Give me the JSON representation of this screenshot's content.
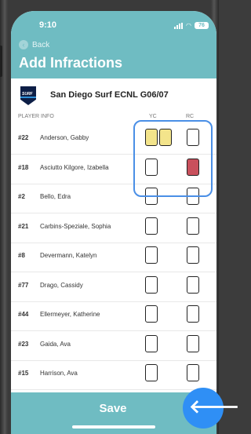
{
  "status": {
    "time": "9:10",
    "battery": "76"
  },
  "nav": {
    "back_label": "Back"
  },
  "page": {
    "title": "Add Infractions"
  },
  "team": {
    "name": "San Diego Surf ECNL G06/07",
    "logo_text": "SURF"
  },
  "columns": {
    "player_info": "PLAYER INFO",
    "yc": "YC",
    "rc": "RC"
  },
  "players": [
    {
      "number": "#22",
      "name": "Anderson, Gabby",
      "yc1": true,
      "yc2": true,
      "rc": false
    },
    {
      "number": "#18",
      "name": "Asciutto Kilgore, Izabella",
      "yc1": false,
      "rc": true
    },
    {
      "number": "#2",
      "name": "Bello, Edra",
      "yc1": false,
      "rc": false
    },
    {
      "number": "#21",
      "name": "Carbins-Speziale, Sophia",
      "yc1": false,
      "rc": false
    },
    {
      "number": "#8",
      "name": "Devermann, Katelyn",
      "yc1": false,
      "rc": false
    },
    {
      "number": "#77",
      "name": "Drago, Cassidy",
      "yc1": false,
      "rc": false
    },
    {
      "number": "#44",
      "name": "Ellermeyer, Katherine",
      "yc1": false,
      "rc": false
    },
    {
      "number": "#23",
      "name": "Gaida, Ava",
      "yc1": false,
      "rc": false
    },
    {
      "number": "#15",
      "name": "Harrison, Ava",
      "yc1": false,
      "rc": false
    }
  ],
  "footer": {
    "save_label": "Save"
  },
  "colors": {
    "header": "#6fbcc2",
    "yellow_card": "#f3e48b",
    "red_card": "#c9505c",
    "fab": "#2f8ff5",
    "highlight": "#4a8fe6"
  },
  "icons": {
    "back": "chevron-left-icon",
    "fab": "arrow-left-icon"
  }
}
